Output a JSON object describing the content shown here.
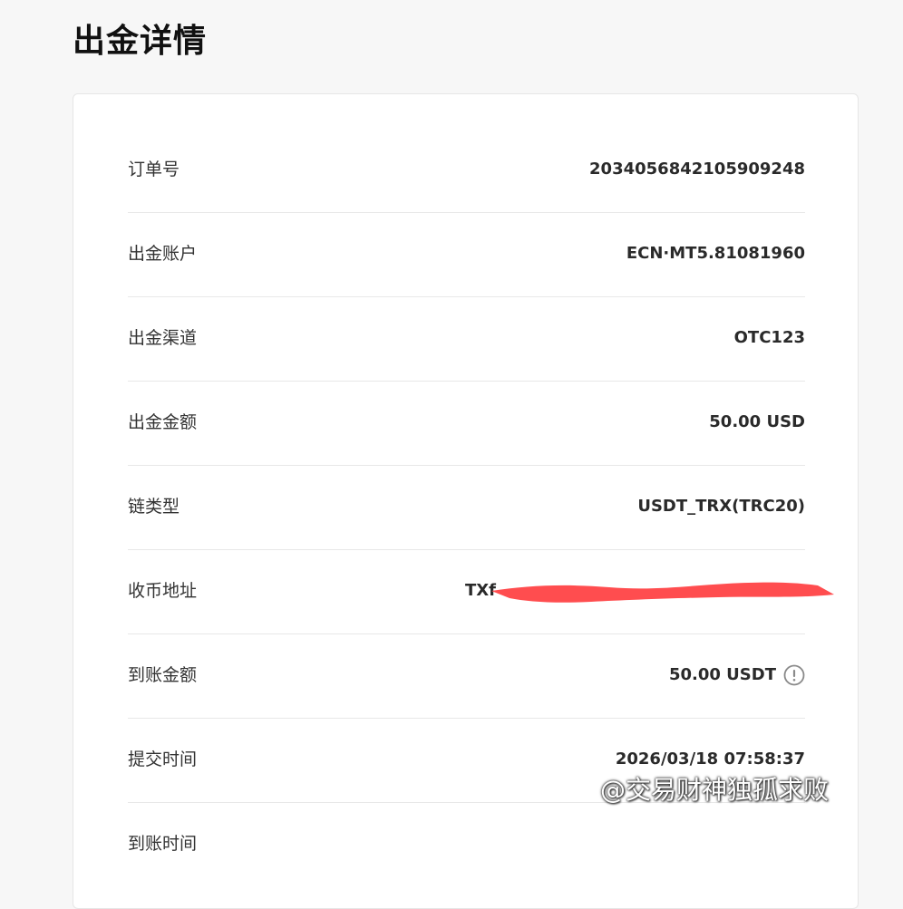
{
  "page": {
    "title": "出金详情"
  },
  "details": {
    "order_no": {
      "label": "订单号",
      "value": "2034056842105909248"
    },
    "account": {
      "label": "出金账户",
      "value": "ECN·MT5.81081960"
    },
    "channel": {
      "label": "出金渠道",
      "value": "OTC123"
    },
    "amount": {
      "label": "出金金额",
      "value": "50.00 USD"
    },
    "chain": {
      "label": "链类型",
      "value": "USDT_TRX(TRC20)"
    },
    "address": {
      "label": "收币地址",
      "value": "TXf"
    },
    "received": {
      "label": "到账金额",
      "value": "50.00 USDT"
    },
    "submitted": {
      "label": "提交时间",
      "value": "2026/03/18 07:58:37"
    },
    "arrival": {
      "label": "到账时间"
    }
  },
  "colors": {
    "redaction": "#ff4d4f",
    "background": "#f7f7f7",
    "card": "#ffffff"
  },
  "icons": {
    "received_info": "info-icon"
  },
  "watermark": {
    "text": "@交易财神独孤求败"
  }
}
